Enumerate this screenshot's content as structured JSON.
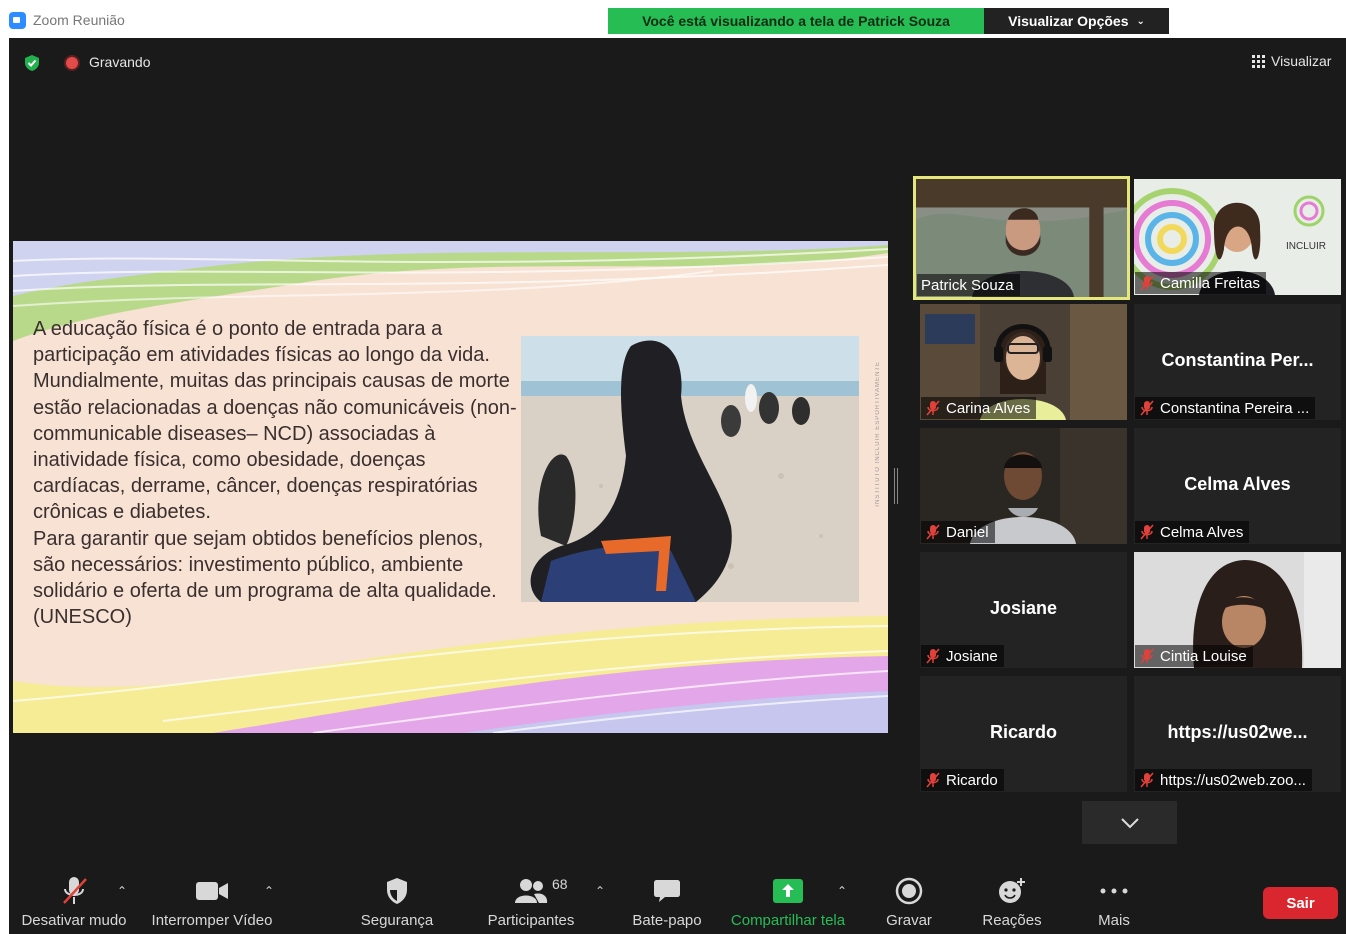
{
  "window": {
    "title": "Zoom Reunião"
  },
  "share_banner": "Você está visualizando a tela de Patrick Souza",
  "view_options": "Visualizar Opções",
  "top": {
    "recording": "Gravando",
    "view": "Visualizar"
  },
  "slide": {
    "text_1": "A educação física é o ponto de entrada para a participação em atividades físicas ao longo da vida. Mundialmente, muitas das principais causas de morte estão relacionadas a doenças não comunicáveis (non-communicable diseases– NCD) associadas à inatividade física, como obesidade, doenças cardíacas, derrame, câncer, doenças respiratórias crônicas e diabetes.",
    "text_2": "Para garantir que sejam obtidos benefícios plenos, são necessários: investimento público, ambiente solidário e oferta de um programa de alta qualidade. (UNESCO)",
    "vertical_text": "INSTITUTO INCLUIR ESPORTIVAMENTE"
  },
  "participants": [
    {
      "label": "Patrick Souza",
      "center": "",
      "muted": false,
      "video": "man-beard"
    },
    {
      "label": "Camilla Freitas",
      "center": "",
      "muted": true,
      "video": "woman-logo",
      "logo_text": "INCLUIR"
    },
    {
      "label": "Carina Alves",
      "center": "",
      "muted": true,
      "video": "woman-headset"
    },
    {
      "label": "Constantina Pereira ...",
      "center": "Constantina  Per...",
      "muted": true,
      "video": ""
    },
    {
      "label": "Daniel",
      "center": "",
      "muted": true,
      "video": "man-dark"
    },
    {
      "label": "Celma Alves",
      "center": "Celma Alves",
      "muted": true,
      "video": ""
    },
    {
      "label": "Josiane",
      "center": "Josiane",
      "muted": true,
      "video": ""
    },
    {
      "label": "Cintia Louise",
      "center": "",
      "muted": true,
      "video": "woman-dark-hair"
    },
    {
      "label": "Ricardo",
      "center": "Ricardo",
      "muted": true,
      "video": ""
    },
    {
      "label": "https://us02web.zoo...",
      "center": "https://us02we...",
      "muted": true,
      "video": ""
    }
  ],
  "toolbar": {
    "mute": "Desativar mudo",
    "video": "Interromper Vídeo",
    "security": "Segurança",
    "participants": "Participantes",
    "participants_count": "68",
    "chat": "Bate-papo",
    "share": "Compartilhar tela",
    "record": "Gravar",
    "reactions": "Reações",
    "more": "Mais",
    "leave": "Sair"
  },
  "colors": {
    "share_green": "#26bd55",
    "leave_red": "#d9262f",
    "active_speaker": "#e5e67b",
    "mute_red": "#e0413a"
  }
}
